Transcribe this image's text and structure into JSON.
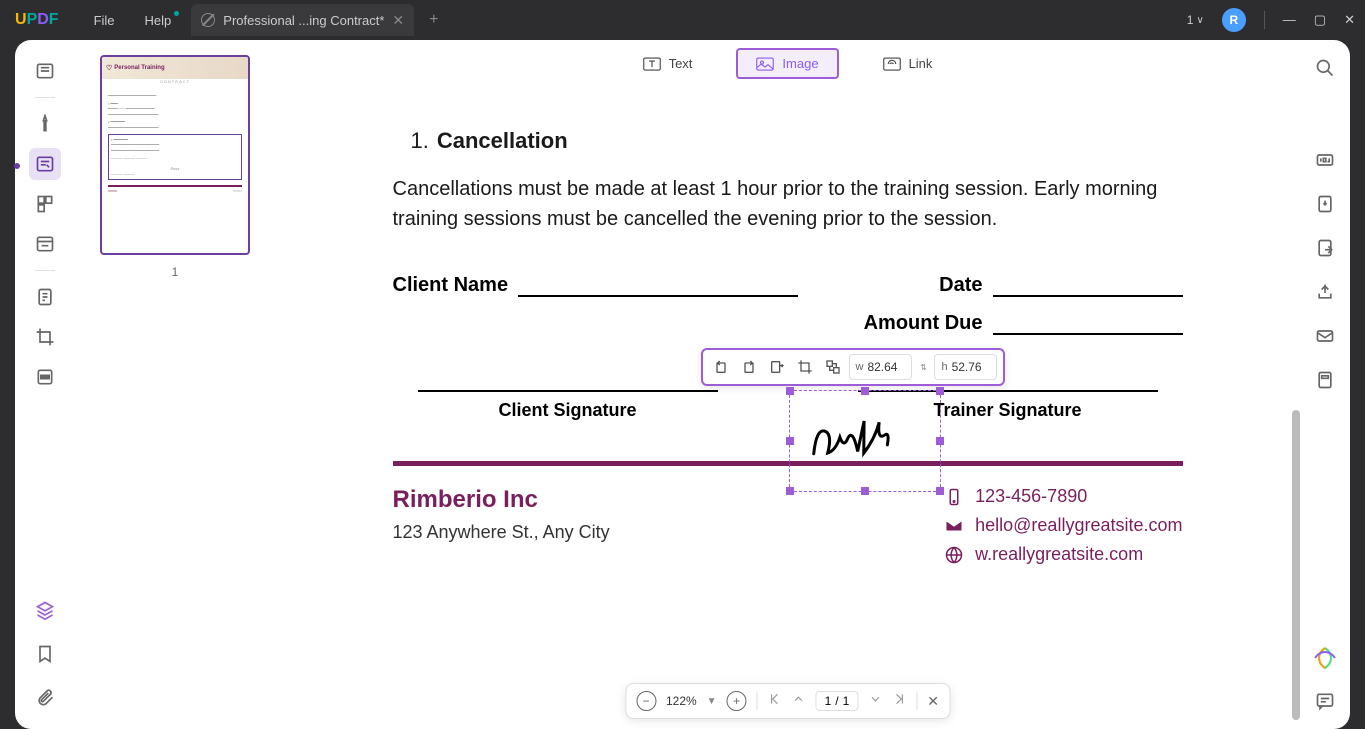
{
  "titlebar": {
    "menus": {
      "file": "File",
      "help": "Help"
    },
    "tab_title": "Professional ...ing Contract*",
    "trial_badge": "1",
    "avatar_letter": "R"
  },
  "toolbar": {
    "text": "Text",
    "image": "Image",
    "link": "Link"
  },
  "document": {
    "section_number": "1.",
    "section_title": "Cancellation",
    "body": "Cancellations must be made at least 1 hour prior to the training session. Early morning training sessions must be cancelled the evening prior to the session.",
    "fields": {
      "client_name": "Client Name",
      "date": "Date",
      "amount_due": "Amount Due",
      "client_signature": "Client Signature",
      "trainer_signature": "Trainer Signature"
    },
    "footer": {
      "company": "Rimberio Inc",
      "address": "123 Anywhere St., Any City",
      "phone": "123-456-7890",
      "email": "hello@reallygreatsite.com",
      "web": "w.reallygreatsite.com"
    }
  },
  "image_toolbar": {
    "w_label": "w",
    "w_value": "82.64",
    "h_label": "h",
    "h_value": "52.76"
  },
  "thumb": {
    "title": "Personal Training",
    "subtitle": "CONTRACT",
    "page_number": "1"
  },
  "bottom_bar": {
    "zoom": "122%",
    "page_current": "1",
    "page_sep": "/",
    "page_total": "1"
  }
}
